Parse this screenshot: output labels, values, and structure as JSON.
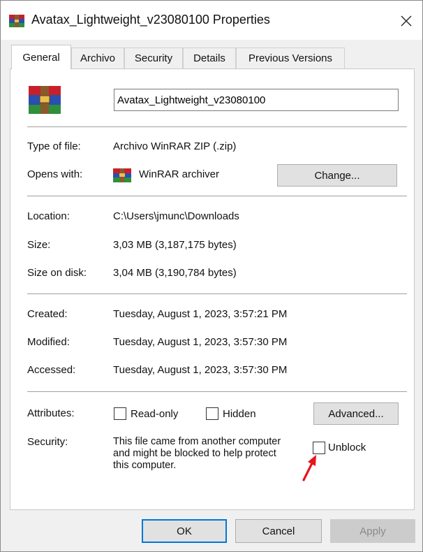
{
  "window": {
    "title": "Avatax_Lightweight_v23080100 Properties",
    "close_glyph": "✕"
  },
  "tabs": [
    {
      "label": "General",
      "active": true
    },
    {
      "label": "Archivo",
      "active": false
    },
    {
      "label": "Security",
      "active": false
    },
    {
      "label": "Details",
      "active": false
    },
    {
      "label": "Previous Versions",
      "active": false
    }
  ],
  "general": {
    "file_name": "Avatax_Lightweight_v23080100",
    "type_label": "Type of file:",
    "type_value": "Archivo WinRAR ZIP (.zip)",
    "opens_label": "Opens with:",
    "opens_value": "WinRAR archiver",
    "change_button": "Change...",
    "location_label": "Location:",
    "location_value": "C:\\Users\\jmunc\\Downloads",
    "size_label": "Size:",
    "size_value": "3,03 MB (3,187,175 bytes)",
    "size_disk_label": "Size on disk:",
    "size_disk_value": "3,04 MB (3,190,784 bytes)",
    "created_label": "Created:",
    "created_value": "Tuesday, August 1, 2023, 3:57:21 PM",
    "modified_label": "Modified:",
    "modified_value": "Tuesday, August 1, 2023, 3:57:30 PM",
    "accessed_label": "Accessed:",
    "accessed_value": "Tuesday, August 1, 2023, 3:57:30 PM",
    "attributes_label": "Attributes:",
    "readonly_label": "Read-only",
    "hidden_label": "Hidden",
    "advanced_button": "Advanced...",
    "security_label": "Security:",
    "security_line1": "This file came from another computer",
    "security_line2": "and might be blocked to help protect",
    "security_line3": "this computer.",
    "unblock_label": "Unblock"
  },
  "footer": {
    "ok": "OK",
    "cancel": "Cancel",
    "apply": "Apply"
  },
  "colors": {
    "accent_border": "#0078d7",
    "annotation_arrow": "#e8141c",
    "winrar_red": "#c8202a",
    "winrar_blue": "#2a4fb0",
    "winrar_green": "#2f8f3a"
  },
  "icons": {
    "title": "winrar-archive-icon",
    "large": "winrar-archive-icon",
    "opens_with": "winrar-archive-icon"
  }
}
